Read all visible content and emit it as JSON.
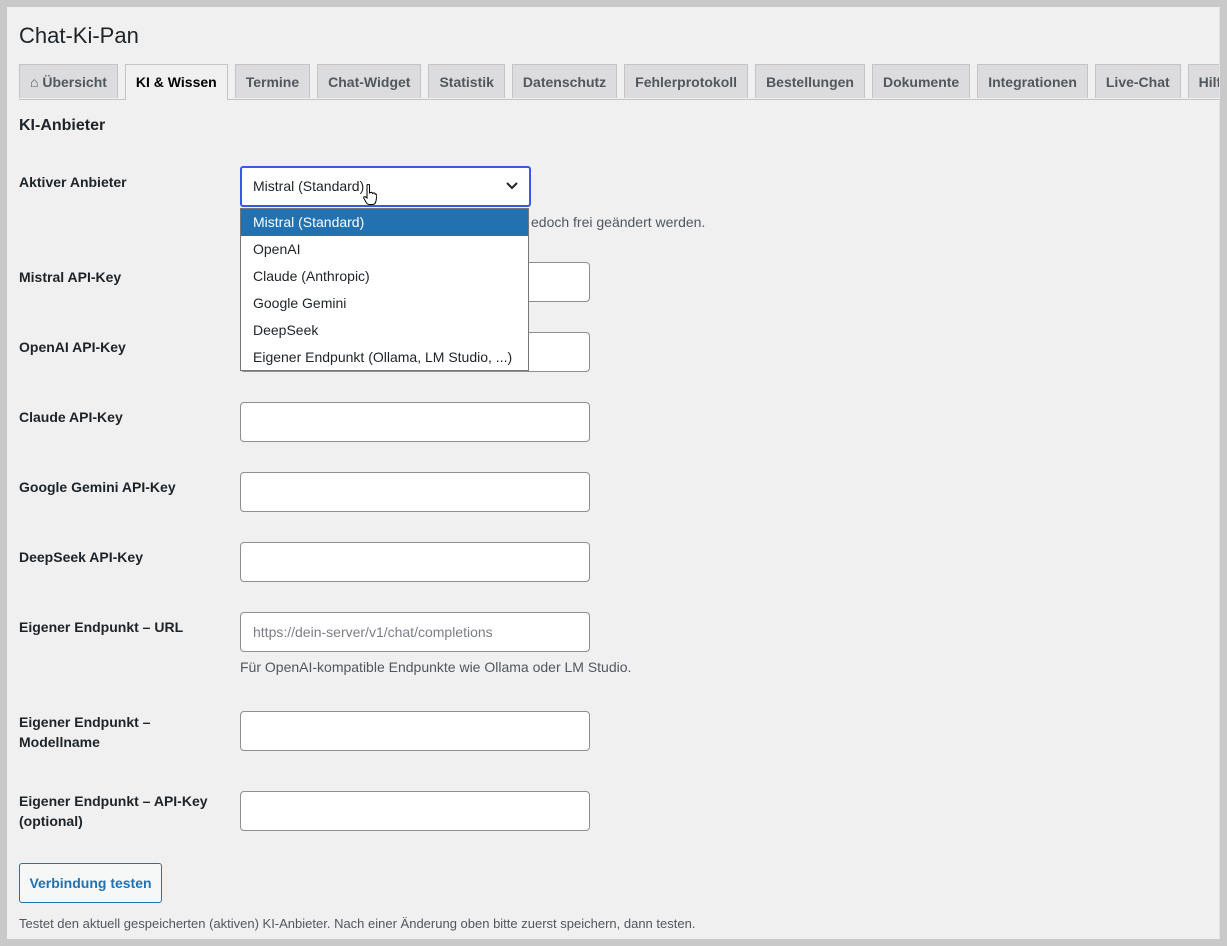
{
  "app": {
    "title": "Chat-Ki-Pan"
  },
  "tabs": [
    {
      "icon": "home-icon",
      "label": "⌂ Übersicht",
      "active": false
    },
    {
      "label": "KI & Wissen",
      "active": true
    },
    {
      "label": "Termine",
      "active": false
    },
    {
      "label": "Chat-Widget",
      "active": false
    },
    {
      "label": "Statistik",
      "active": false
    },
    {
      "label": "Datenschutz",
      "active": false
    },
    {
      "label": "Fehlerprotokoll",
      "active": false
    },
    {
      "label": "Bestellungen",
      "active": false
    },
    {
      "label": "Dokumente",
      "active": false
    },
    {
      "label": "Integrationen",
      "active": false
    },
    {
      "label": "Live-Chat",
      "active": false
    },
    {
      "label": "Hilfe",
      "active": false
    }
  ],
  "section": {
    "title": "KI-Anbieter"
  },
  "provider": {
    "label": "Aktiver Anbieter",
    "selected": "Mistral (Standard)",
    "description_visible": "edoch frei geändert werden.",
    "options": [
      "Mistral (Standard)",
      "OpenAI",
      "Claude (Anthropic)",
      "Google Gemini",
      "DeepSeek",
      "Eigener Endpunkt (Ollama, LM Studio, ...)"
    ]
  },
  "fields": {
    "mistral": {
      "label": "Mistral API-Key",
      "value": ""
    },
    "openai": {
      "label": "OpenAI API-Key",
      "value": ""
    },
    "claude": {
      "label": "Claude API-Key",
      "value": ""
    },
    "gemini": {
      "label": "Google Gemini API-Key",
      "value": ""
    },
    "deepseek": {
      "label": "DeepSeek API-Key",
      "value": ""
    },
    "endpoint_url": {
      "label": "Eigener Endpunkt – URL",
      "placeholder": "https://dein-server/v1/chat/completions",
      "description": "Für OpenAI-kompatible Endpunkte wie Ollama oder LM Studio."
    },
    "endpoint_model": {
      "label_line1": "Eigener Endpunkt –",
      "label_line2": "Modellname",
      "value": ""
    },
    "endpoint_key": {
      "label_line1": "Eigener Endpunkt – API-Key",
      "label_line2": "(optional)",
      "value": ""
    }
  },
  "test": {
    "button_label": "Verbindung testen",
    "note": "Testet den aktuell gespeicherten (aktiven) KI-Anbieter. Nach einer Änderung oben bitte zuerst speichern, dann testen."
  },
  "colors": {
    "accent": "#3858e9",
    "selected_option": "#2271b1",
    "button_text": "#2271b1"
  }
}
